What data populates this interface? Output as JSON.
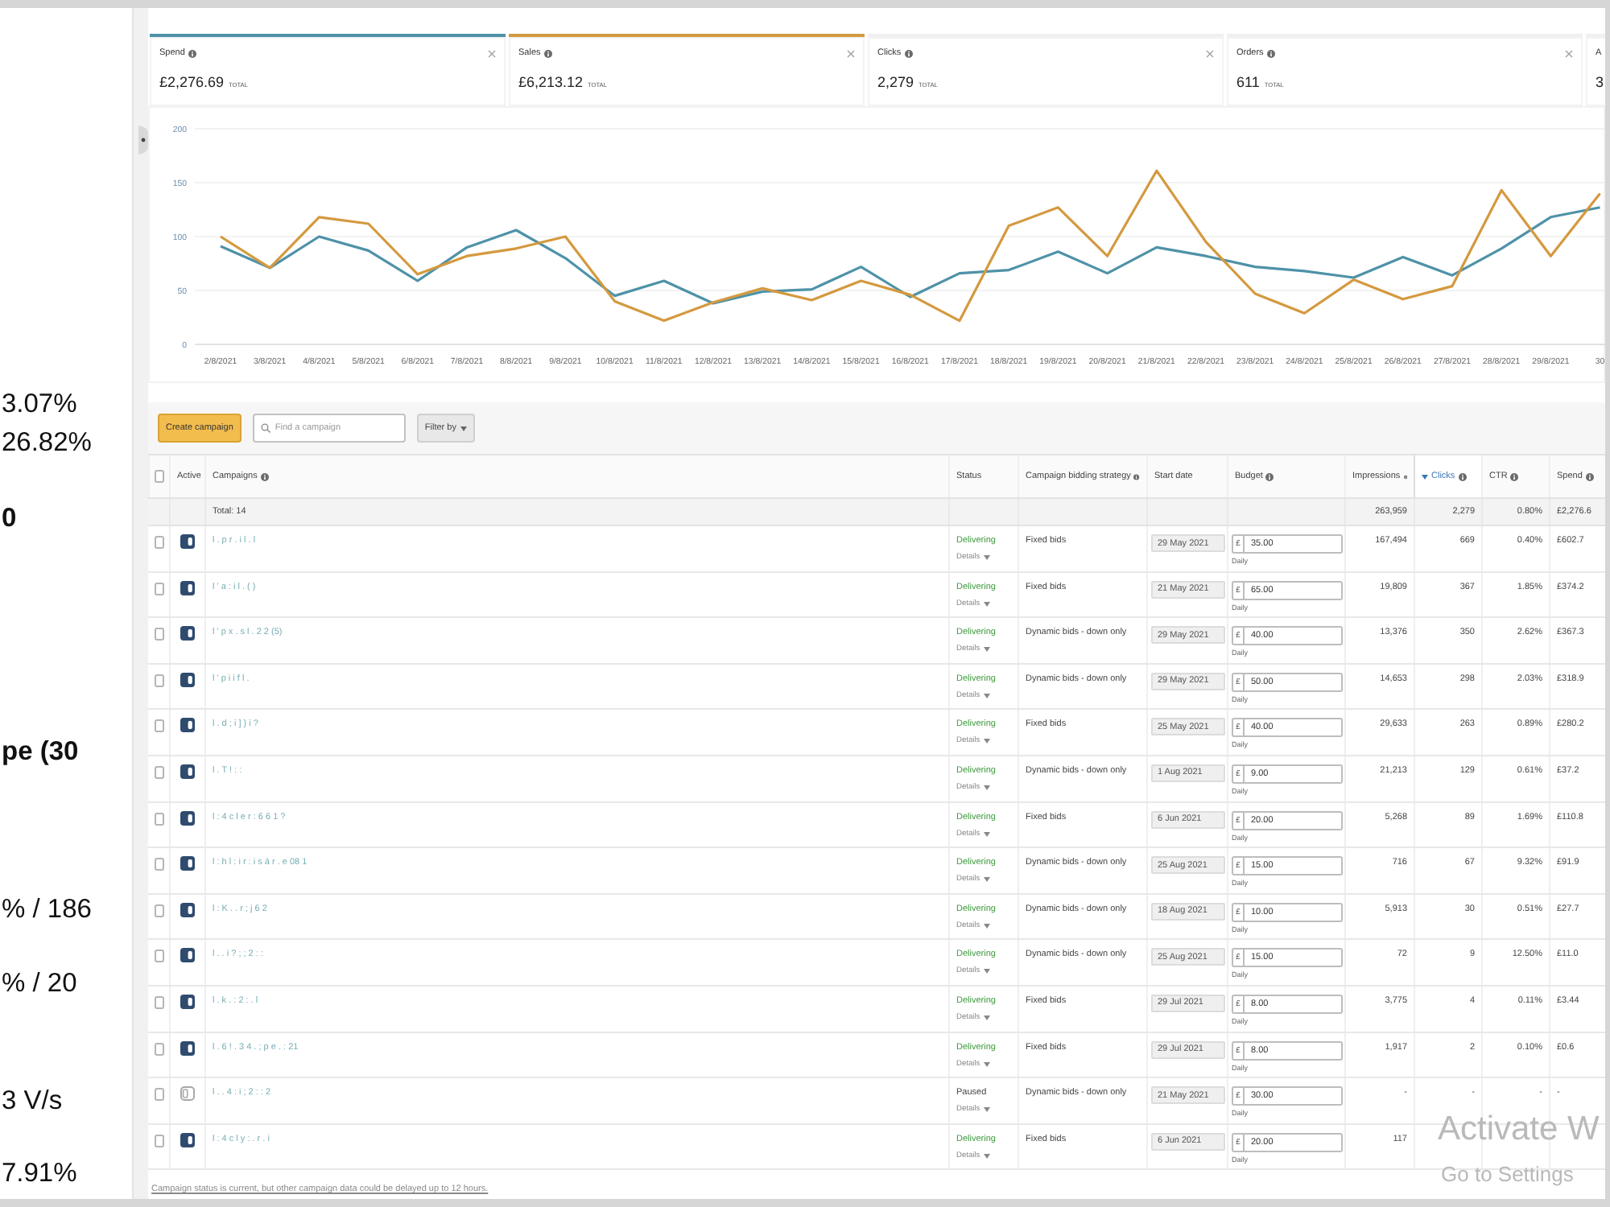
{
  "side_panel": {
    "lines": [
      {
        "text": "3.07%",
        "bold": false
      },
      {
        "text": "26.82%",
        "bold": false
      },
      {
        "text": "0",
        "bold": true
      },
      {
        "text": "pe (30",
        "bold": true
      },
      {
        "text": "% / 186",
        "bold": false
      },
      {
        "text": "% / 20",
        "bold": false
      },
      {
        "text": "3 V/s",
        "bold": false
      },
      {
        "text": "7.91%",
        "bold": false
      }
    ]
  },
  "metrics": [
    {
      "label": "Spend",
      "info": true,
      "value": "£2,276.69",
      "suffix": "TOTAL",
      "selected": true,
      "color": "#4e92a8",
      "closable": true
    },
    {
      "label": "Sales",
      "info": true,
      "value": "£6,213.12",
      "suffix": "TOTAL",
      "selected": true,
      "color": "#d4993f",
      "closable": true
    },
    {
      "label": "Clicks",
      "info": true,
      "value": "2,279",
      "suffix": "TOTAL",
      "selected": false,
      "closable": true
    },
    {
      "label": "Orders",
      "info": true,
      "value": "611",
      "suffix": "TOTAL",
      "selected": false,
      "closable": true
    },
    {
      "label": "A",
      "info": false,
      "value": "3",
      "selected": false,
      "closable": false
    }
  ],
  "chart": {
    "chart_data": {
      "type": "line",
      "grid": true,
      "categories": [
        "2/8/2021",
        "3/8/2021",
        "4/8/2021",
        "5/8/2021",
        "6/8/2021",
        "7/8/2021",
        "8/8/2021",
        "9/8/2021",
        "10/8/2021",
        "11/8/2021",
        "12/8/2021",
        "13/8/2021",
        "14/8/2021",
        "15/8/2021",
        "16/8/2021",
        "17/8/2021",
        "18/8/2021",
        "19/8/2021",
        "20/8/2021",
        "21/8/2021",
        "22/8/2021",
        "23/8/2021",
        "24/8/2021",
        "25/8/2021",
        "26/8/2021",
        "27/8/2021",
        "28/8/2021",
        "29/8/2021",
        "30"
      ],
      "ylim": [
        0,
        200
      ],
      "yticks": [
        0,
        50,
        100,
        150,
        200
      ],
      "series": [
        {
          "color": "#4e92a8",
          "values": [
            91,
            71,
            100,
            87,
            59,
            90,
            106,
            80,
            45,
            59,
            38,
            49,
            51,
            72,
            44,
            66,
            69,
            86,
            66,
            90,
            82,
            72,
            68,
            62,
            81,
            64,
            89,
            118,
            127
          ]
        },
        {
          "color": "#d4993f",
          "values": [
            100,
            71,
            118,
            112,
            65,
            82,
            89,
            100,
            40,
            22,
            39,
            52,
            41,
            59,
            46,
            22,
            110,
            127,
            82,
            161,
            95,
            47,
            29,
            60,
            42,
            54,
            143,
            82,
            140
          ]
        }
      ]
    }
  },
  "toolbar": {
    "create_button": "Create campaign",
    "search": {
      "placeholder": "Find a campaign"
    },
    "filter_button": "Filter by"
  },
  "table": {
    "select_all": {
      "checked": false
    },
    "columns": [
      {
        "label": "Active",
        "info": false,
        "sorted": false
      },
      {
        "label": "Campaigns",
        "info": true,
        "sorted": false
      },
      {
        "label": "Status",
        "info": false,
        "sorted": false
      },
      {
        "label": "Campaign bidding strategy",
        "info": true,
        "sorted": false
      },
      {
        "label": "Start date",
        "info": false,
        "sorted": false
      },
      {
        "label": "Budget",
        "info": true,
        "sorted": false
      },
      {
        "label": "Impressions",
        "info": true,
        "sorted": false
      },
      {
        "label": "Clicks",
        "info": true,
        "sorted": true
      },
      {
        "label": "CTR",
        "info": true,
        "sorted": false
      },
      {
        "label": "Spend",
        "info": true,
        "sorted": false
      }
    ],
    "total": {
      "label": "Total: 14",
      "impressions": "263,959",
      "clicks": "2,279",
      "ctr": "0.80%",
      "spend": "£2,276.6"
    },
    "rows": [
      {
        "checked": false,
        "active": true,
        "name": "l . p r . i l . l",
        "status": "Delivering",
        "delivering": true,
        "details": "Details",
        "bidding": "Fixed bids",
        "start_date": "29 May 2021",
        "currency": "£",
        "budget": "35.00",
        "period": "Daily",
        "impressions": "167,494",
        "clicks": "669",
        "ctr": "0.40%",
        "spend": "£602.7"
      },
      {
        "checked": false,
        "active": true,
        "name": "l ' a : i l . ( )",
        "status": "Delivering",
        "delivering": true,
        "details": "Details",
        "bidding": "Fixed bids",
        "start_date": "21 May 2021",
        "currency": "£",
        "budget": "65.00",
        "period": "Daily",
        "impressions": "19,809",
        "clicks": "367",
        "ctr": "1.85%",
        "spend": "£374.2"
      },
      {
        "checked": false,
        "active": true,
        "name": "l ' p x . s l . 2 2 (5)",
        "status": "Delivering",
        "delivering": true,
        "details": "Details",
        "bidding": "Dynamic bids - down only",
        "start_date": "29 May 2021",
        "currency": "£",
        "budget": "40.00",
        "period": "Daily",
        "impressions": "13,376",
        "clicks": "350",
        "ctr": "2.62%",
        "spend": "£367.3"
      },
      {
        "checked": false,
        "active": true,
        "name": "l ' p i i f l .",
        "status": "Delivering",
        "delivering": true,
        "details": "Details",
        "bidding": "Dynamic bids - down only",
        "start_date": "29 May 2021",
        "currency": "£",
        "budget": "50.00",
        "period": "Daily",
        "impressions": "14,653",
        "clicks": "298",
        "ctr": "2.03%",
        "spend": "£318.9"
      },
      {
        "checked": false,
        "active": true,
        "name": "l . d ; i ] } i ?",
        "status": "Delivering",
        "delivering": true,
        "details": "Details",
        "bidding": "Fixed bids",
        "start_date": "25 May 2021",
        "currency": "£",
        "budget": "40.00",
        "period": "Daily",
        "impressions": "29,633",
        "clicks": "263",
        "ctr": "0.89%",
        "spend": "£280.2"
      },
      {
        "checked": false,
        "active": true,
        "name": "l . T ! : :",
        "status": "Delivering",
        "delivering": true,
        "details": "Details",
        "bidding": "Dynamic bids - down only",
        "start_date": "1 Aug 2021",
        "currency": "£",
        "budget": "9.00",
        "period": "Daily",
        "impressions": "21,213",
        "clicks": "129",
        "ctr": "0.61%",
        "spend": "£37.2"
      },
      {
        "checked": false,
        "active": true,
        "name": "l : 4 c l e r : 6 6 1 ?",
        "status": "Delivering",
        "delivering": true,
        "details": "Details",
        "bidding": "Fixed bids",
        "start_date": "6 Jun 2021",
        "currency": "£",
        "budget": "20.00",
        "period": "Daily",
        "impressions": "5,268",
        "clicks": "89",
        "ctr": "1.69%",
        "spend": "£110.8"
      },
      {
        "checked": false,
        "active": true,
        "name": "l : h l : i r : i s á r . e 08 1",
        "status": "Delivering",
        "delivering": true,
        "details": "Details",
        "bidding": "Dynamic bids - down only",
        "start_date": "25 Aug 2021",
        "currency": "£",
        "budget": "15.00",
        "period": "Daily",
        "impressions": "716",
        "clicks": "67",
        "ctr": "9.32%",
        "spend": "£91.9"
      },
      {
        "checked": false,
        "active": true,
        "name": "l : K . . r ; j 6 2",
        "status": "Delivering",
        "delivering": true,
        "details": "Details",
        "bidding": "Dynamic bids - down only",
        "start_date": "18 Aug 2021",
        "currency": "£",
        "budget": "10.00",
        "period": "Daily",
        "impressions": "5,913",
        "clicks": "30",
        "ctr": "0.51%",
        "spend": "£27.7"
      },
      {
        "checked": false,
        "active": true,
        "name": "l . . i ? ; ; 2 : :",
        "status": "Delivering",
        "delivering": true,
        "details": "Details",
        "bidding": "Dynamic bids - down only",
        "start_date": "25 Aug 2021",
        "currency": "£",
        "budget": "15.00",
        "period": "Daily",
        "impressions": "72",
        "clicks": "9",
        "ctr": "12.50%",
        "spend": "£11.0"
      },
      {
        "checked": false,
        "active": true,
        "name": "l . k . : 2 : . l",
        "status": "Delivering",
        "delivering": true,
        "details": "Details",
        "bidding": "Fixed bids",
        "start_date": "29 Jul 2021",
        "currency": "£",
        "budget": "8.00",
        "period": "Daily",
        "impressions": "3,775",
        "clicks": "4",
        "ctr": "0.11%",
        "spend": "£3.44"
      },
      {
        "checked": false,
        "active": true,
        "name": "l . 6 ! . 3 4 . ; p e . : 21",
        "status": "Delivering",
        "delivering": true,
        "details": "Details",
        "bidding": "Fixed bids",
        "start_date": "29 Jul 2021",
        "currency": "£",
        "budget": "8.00",
        "period": "Daily",
        "impressions": "1,917",
        "clicks": "2",
        "ctr": "0.10%",
        "spend": "£0.6"
      },
      {
        "checked": false,
        "active": false,
        "name": "l . . 4 : i ; 2 : : 2",
        "status": "Paused",
        "delivering": false,
        "details": "Details",
        "bidding": "Dynamic bids - down only",
        "start_date": "21 May 2021",
        "currency": "£",
        "budget": "30.00",
        "period": "Daily",
        "impressions": "-",
        "clicks": "-",
        "ctr": "-",
        "spend": "-"
      },
      {
        "checked": false,
        "active": true,
        "name": "l : 4 c l y : . r . i",
        "status": "Delivering",
        "delivering": true,
        "details": "Details",
        "bidding": "Fixed bids",
        "start_date": "6 Jun 2021",
        "currency": "£",
        "budget": "20.00",
        "period": "Daily",
        "impressions": "117"
      }
    ],
    "note": "Campaign status is current, but other campaign data could be delayed up to 12 hours."
  },
  "os_notice": {
    "title": "Activate W",
    "subtitle": "Go to Settings"
  }
}
